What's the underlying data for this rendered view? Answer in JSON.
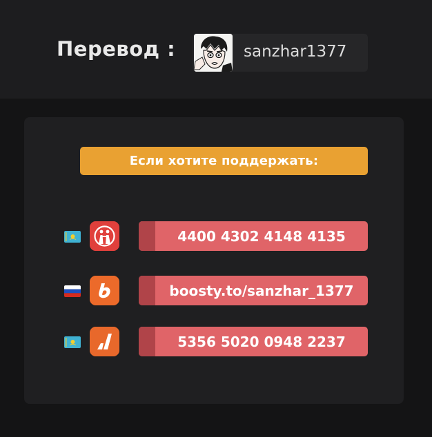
{
  "header": {
    "title": "Перевод :",
    "user": {
      "avatar_icon": "manga-face-avatar",
      "username": "sanzhar1377"
    }
  },
  "card": {
    "support_label": "Если хотите поддержать:",
    "rows": [
      {
        "flag": "kazakhstan-flag",
        "app_icon": "kaspi-icon",
        "app_color": "#e0403c",
        "value": "4400 4302 4148 4135"
      },
      {
        "flag": "russia-flag",
        "app_icon": "boosty-icon",
        "app_color": "#ec6a2a",
        "value": "boosty.to/sanzhar_1377"
      },
      {
        "flag": "kazakhstan-flag",
        "app_icon": "freedom-bank-icon",
        "app_color": "#e8682b",
        "value": "5356 5020 0948 2237"
      }
    ]
  },
  "colors": {
    "header_bg": "#1d1d1f",
    "card_bg": "#1f1f21",
    "accent_banner": "#e9a132",
    "button_bg": "#e06468",
    "button_edge": "#b04449"
  }
}
